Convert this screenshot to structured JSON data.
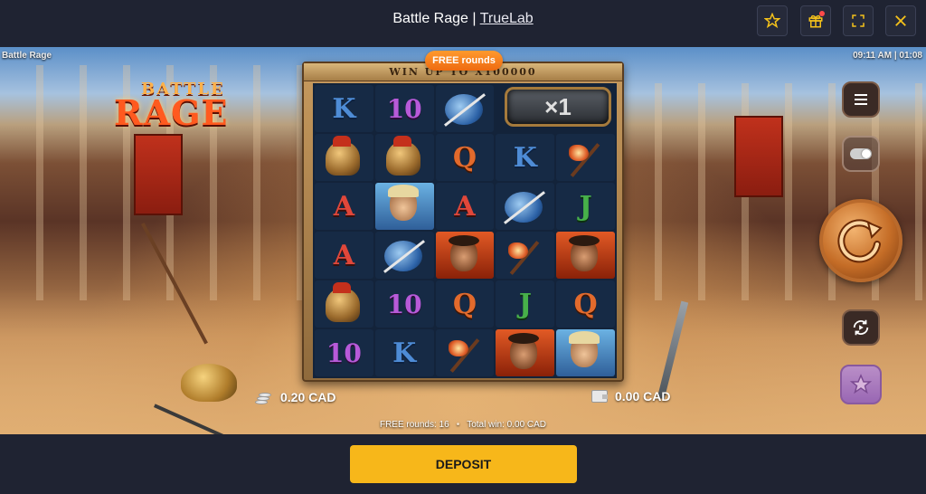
{
  "header": {
    "game_title": "Battle Rage",
    "separator": " | ",
    "provider": "TrueLab",
    "buttons": [
      {
        "name": "favorite",
        "icon": "star-icon"
      },
      {
        "name": "gift",
        "icon": "gift-icon"
      },
      {
        "name": "fullscreen",
        "icon": "fullscreen-icon"
      },
      {
        "name": "close",
        "icon": "close-icon"
      }
    ],
    "accent_color": "#f5c21b"
  },
  "game": {
    "corner_title": "Battle Rage",
    "clock": "09:11 AM | 01:08",
    "logo_top": "BATTLE",
    "logo_bottom": "RAGE",
    "reels_header": "WIN UP TO X100000",
    "free_rounds_badge": "FREE rounds",
    "multiplier": "×1",
    "reels": [
      [
        "K",
        "10",
        "shield",
        "",
        ""
      ],
      [
        "helmet",
        "helmet",
        "Q",
        "K",
        "axe"
      ],
      [
        "A",
        "hero",
        "A",
        "shield",
        "J"
      ],
      [
        "A",
        "shield",
        "warrior",
        "axe",
        "warrior"
      ],
      [
        "helmet",
        "10",
        "Q",
        "J",
        "Q"
      ],
      [
        "10",
        "K",
        "axe",
        "warrior",
        "hero"
      ]
    ],
    "bet": "0.20 CAD",
    "win": "0.00 CAD",
    "free_rounds_label": "FREE rounds: 16",
    "total_win_label": "Total win: 0.00 CAD",
    "controls": [
      {
        "name": "menu",
        "icon": "menu-icon"
      },
      {
        "name": "turbo-toggle",
        "icon": "toggle-icon"
      },
      {
        "name": "spin",
        "icon": "spin-arrow-icon"
      },
      {
        "name": "autoplay",
        "icon": "autoplay-icon"
      },
      {
        "name": "bonus",
        "icon": "star-badge-icon"
      }
    ]
  },
  "footer": {
    "deposit_label": "DEPOSIT",
    "deposit_color": "#f7b71a"
  }
}
